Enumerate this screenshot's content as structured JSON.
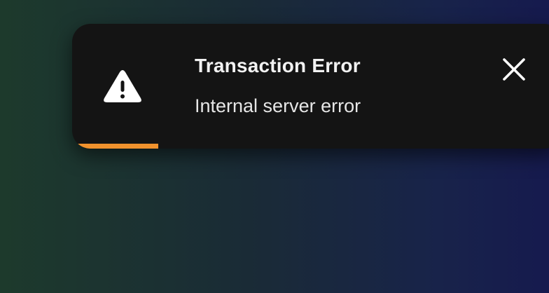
{
  "toast": {
    "title": "Transaction Error",
    "message": "Internal server error",
    "icon": "warning-triangle-icon",
    "close_icon": "close-icon",
    "progress_percent": 17.5,
    "colors": {
      "background": "#141414",
      "progress": "#f0922d",
      "text": "#f2f2f2",
      "icon": "#ffffff"
    }
  }
}
